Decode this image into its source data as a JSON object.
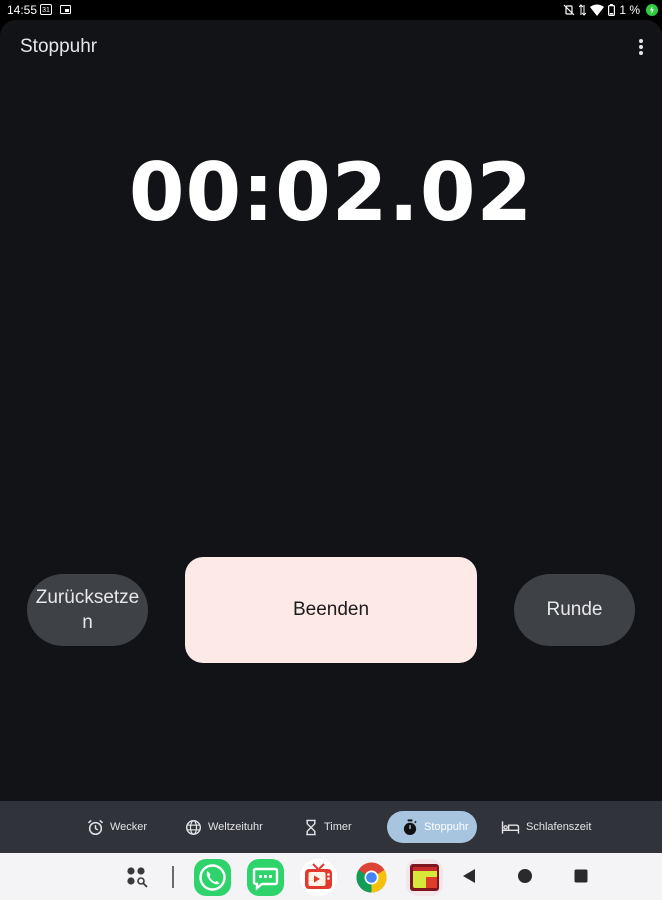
{
  "status_bar": {
    "time": "14:55",
    "calendar_day": "31",
    "battery_percent": "1 %",
    "icons": [
      "calendar-icon",
      "window-icon",
      "mute-vibrate-icon",
      "data-arrows-icon",
      "wifi-icon",
      "battery-icon",
      "charging-icon"
    ]
  },
  "app": {
    "title": "Stoppuhr",
    "menu_icon": "more-vert-icon"
  },
  "stopwatch": {
    "time": "00:02.02"
  },
  "controls": {
    "reset_label": "Zurücksetzen",
    "stop_label": "Beenden",
    "lap_label": "Runde"
  },
  "bottom_nav": {
    "items": [
      {
        "label": "Wecker",
        "icon": "alarm-icon",
        "active": false
      },
      {
        "label": "Weltzeituhr",
        "icon": "globe-icon",
        "active": false
      },
      {
        "label": "Timer",
        "icon": "hourglass-icon",
        "active": false
      },
      {
        "label": "Stoppuhr",
        "icon": "stopwatch-icon",
        "active": true
      },
      {
        "label": "Schlafenszeit",
        "icon": "bed-icon",
        "active": false
      }
    ]
  },
  "taskbar": {
    "apps": [
      "app-drawer-icon",
      "phone-app-icon",
      "messages-app-icon",
      "tv-app-icon",
      "chrome-app-icon",
      "folder-app-icon"
    ],
    "navigation": [
      "back-icon",
      "home-icon",
      "recents-icon"
    ]
  },
  "colors": {
    "app_background": "#111317",
    "stop_button": "#fde9e6",
    "secondary_button": "#3e4146",
    "nav_background": "#30343a",
    "nav_active": "#a8c5e0",
    "taskbar": "#f4f4f6"
  }
}
